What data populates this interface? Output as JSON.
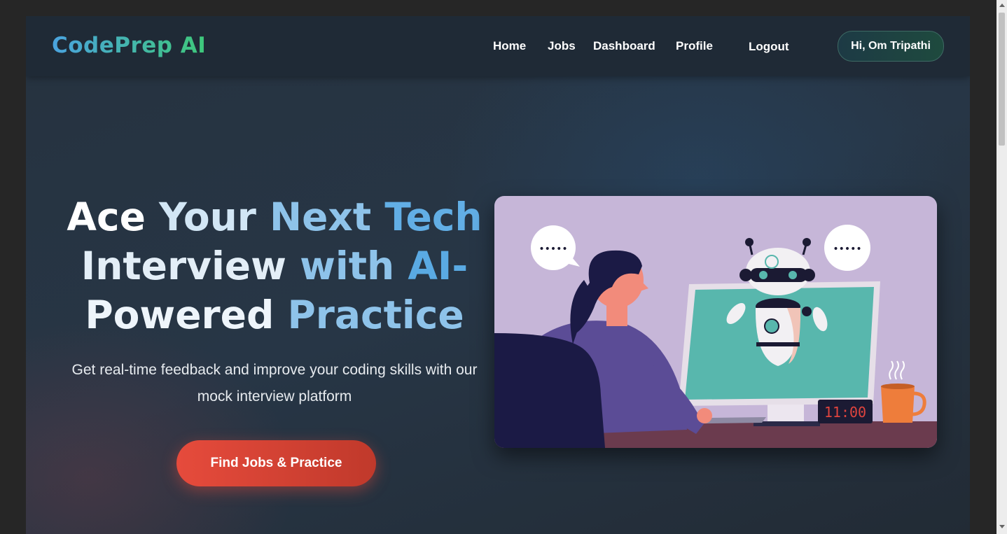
{
  "nav": {
    "logo": "CodePrep AI",
    "links": [
      "Home",
      "Jobs",
      "Dashboard",
      "Profile"
    ],
    "logout": "Logout",
    "greeting": "Hi, Om Tripathi"
  },
  "hero": {
    "title_words": [
      "Ace",
      "Your",
      "Next",
      "Tech",
      "Interview",
      "with",
      "AI-",
      "Powered",
      "Practice"
    ],
    "subtitle": "Get real-time feedback and improve your coding skills with our mock interview platform",
    "cta": "Find Jobs & Practice"
  },
  "illustration": {
    "speech_left": "•••••",
    "speech_right": "•••••",
    "clock": "11:00"
  },
  "colors": {
    "logo_gradient": [
      "#4aa3df",
      "#3ec87a"
    ],
    "cta_gradient": [
      "#e64b3c",
      "#c0392b"
    ],
    "title_gradient": [
      "#ffffff",
      "#3498db"
    ]
  }
}
